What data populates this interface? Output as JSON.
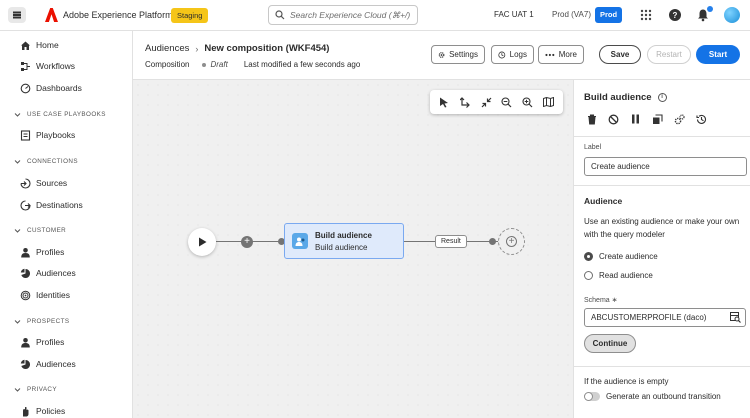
{
  "topbar": {
    "app_name": "Adobe Experience Platform",
    "env_badge": "Staging",
    "search_placeholder": "Search Experience Cloud (⌘+/)",
    "org": "FAC UAT 1",
    "sandbox": "Prod (VA7)",
    "sandbox_badge": "Prod"
  },
  "sidebar": {
    "items_top": [
      {
        "label": "Home",
        "icon": "home-icon"
      },
      {
        "label": "Workflows",
        "icon": "workflows-icon"
      },
      {
        "label": "Dashboards",
        "icon": "dashboards-icon"
      }
    ],
    "sections": [
      {
        "title": "USE CASE PLAYBOOKS",
        "items": [
          {
            "label": "Playbooks",
            "icon": "playbooks-icon"
          }
        ]
      },
      {
        "title": "CONNECTIONS",
        "items": [
          {
            "label": "Sources",
            "icon": "sources-icon"
          },
          {
            "label": "Destinations",
            "icon": "destinations-icon"
          }
        ]
      },
      {
        "title": "CUSTOMER",
        "items": [
          {
            "label": "Profiles",
            "icon": "profile-icon"
          },
          {
            "label": "Audiences",
            "icon": "audiences-icon"
          },
          {
            "label": "Identities",
            "icon": "identities-icon"
          }
        ]
      },
      {
        "title": "PROSPECTS",
        "items": [
          {
            "label": "Profiles",
            "icon": "profile-icon"
          },
          {
            "label": "Audiences",
            "icon": "audiences-icon"
          }
        ]
      },
      {
        "title": "PRIVACY",
        "items": [
          {
            "label": "Policies",
            "icon": "policies-icon"
          }
        ]
      }
    ]
  },
  "header": {
    "breadcrumb_parent": "Audiences",
    "title": "New composition (WKF454)",
    "type": "Composition",
    "status": "Draft",
    "modified": "Last modified a few seconds ago",
    "settings_label": "Settings",
    "logs_label": "Logs",
    "more_label": "More",
    "save_label": "Save",
    "restart_label": "Restart",
    "start_label": "Start"
  },
  "canvas": {
    "node_title": "Build audience",
    "node_subtitle": "Build audience",
    "result_label": "Result"
  },
  "panel": {
    "title": "Build audience",
    "label_caption": "Label",
    "label_value": "Create audience",
    "audience_heading": "Audience",
    "audience_desc": "Use an existing audience or make your own with the query modeler",
    "radio_create": "Create audience",
    "radio_read": "Read audience",
    "schema_caption": "Schema ∗",
    "schema_value": "ABCUSTOMERPROFILE (daco)",
    "continue_label": "Continue",
    "empty_heading": "If the audience is empty",
    "toggle_label": "Generate an outbound transition"
  },
  "colors": {
    "accent": "#1473e6",
    "staging": "#f5c518",
    "node_fill": "#dfeafb",
    "canvas_bg": "#f0f0f0"
  }
}
